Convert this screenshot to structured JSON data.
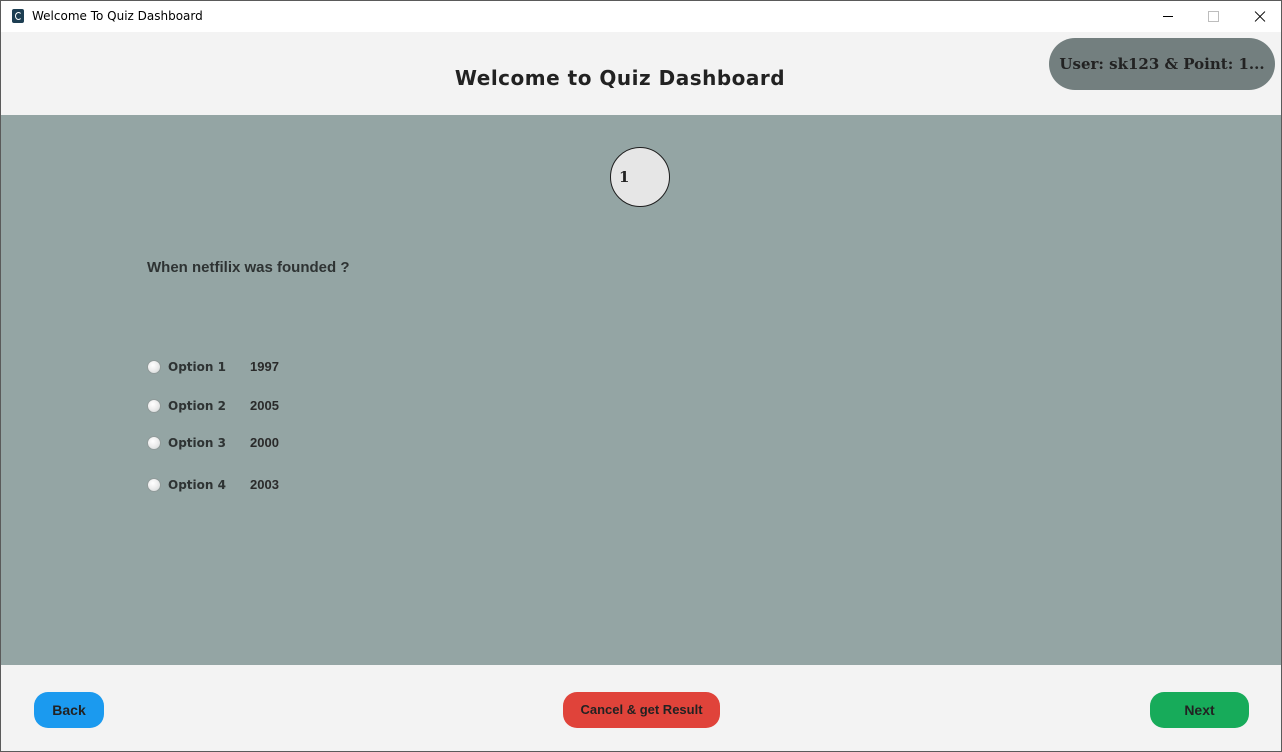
{
  "window": {
    "title": "Welcome To Quiz Dashboard"
  },
  "header": {
    "title": "Welcome to Quiz Dashboard",
    "user_badge": "User: sk123 & Point: 1..."
  },
  "quiz": {
    "question_number": "1",
    "question": "When netfilix was founded ?",
    "options": [
      {
        "label": "Option 1",
        "value": "1997",
        "selected": false
      },
      {
        "label": "Option 2",
        "value": "2005",
        "selected": false
      },
      {
        "label": "Option 3",
        "value": "2000",
        "selected": false
      },
      {
        "label": "Option 4",
        "value": "2003",
        "selected": false
      }
    ]
  },
  "footer": {
    "back_label": "Back",
    "cancel_label": "Cancel & get Result",
    "next_label": "Next"
  },
  "colors": {
    "panel_background": "#94a5a4",
    "header_background": "#f3f3f3",
    "user_badge": "#737f7f",
    "back_button": "#1b9aef",
    "cancel_button": "#e0433a",
    "next_button": "#17ab5a"
  },
  "icons": {
    "app": "app-icon",
    "minimize": "minimize-icon",
    "maximize": "maximize-icon",
    "close": "close-icon"
  }
}
